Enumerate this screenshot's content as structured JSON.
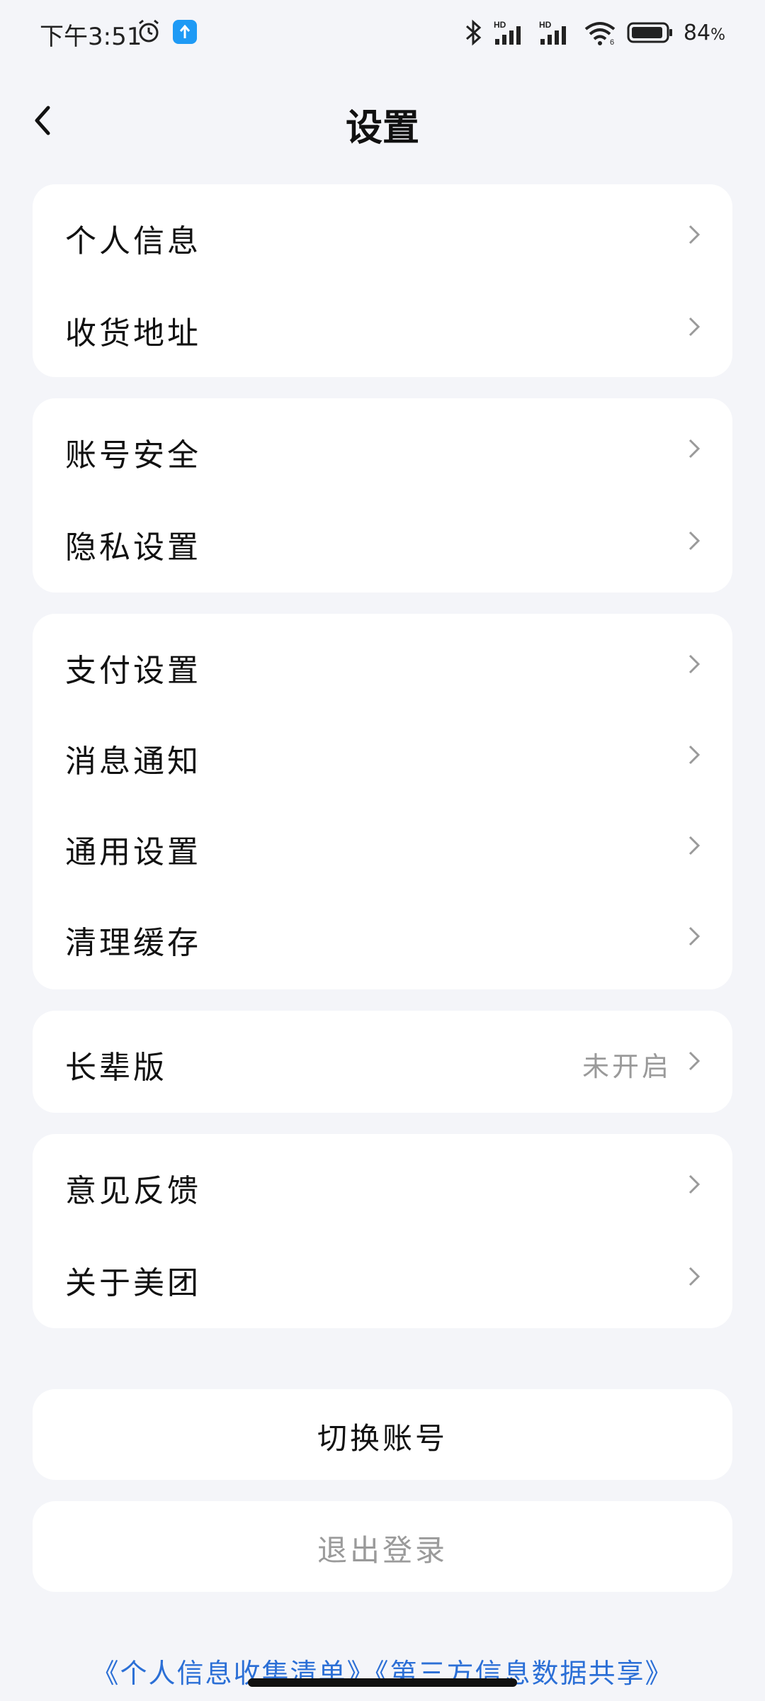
{
  "status_bar": {
    "time": "下午3:51",
    "network_hd1": "HD",
    "network_hd2": "HD",
    "wifi_sub": "6",
    "battery_pct": "84",
    "battery_suffix": "%"
  },
  "header": {
    "title": "设置",
    "back_icon": "chevron-left-icon"
  },
  "groups": [
    {
      "items": [
        {
          "label": "个人信息"
        },
        {
          "label": "收货地址"
        }
      ]
    },
    {
      "items": [
        {
          "label": "账号安全"
        },
        {
          "label": "隐私设置"
        }
      ]
    },
    {
      "items": [
        {
          "label": "支付设置"
        },
        {
          "label": "消息通知"
        },
        {
          "label": "通用设置"
        },
        {
          "label": "清理缓存"
        }
      ]
    },
    {
      "items": [
        {
          "label": "长辈版",
          "value": "未开启"
        }
      ]
    },
    {
      "items": [
        {
          "label": "意见反馈"
        },
        {
          "label": "关于美团"
        }
      ]
    }
  ],
  "actions": {
    "switch_account": "切换账号",
    "logout": "退出登录"
  },
  "footer": {
    "links": "《个人信息收集清单》《第三方信息数据共享》"
  },
  "colors": {
    "background": "#f4f5f9",
    "card": "#ffffff",
    "muted_text": "#9a9a9a",
    "link": "#2b6fd6",
    "app_badge": "#1e9af5"
  }
}
